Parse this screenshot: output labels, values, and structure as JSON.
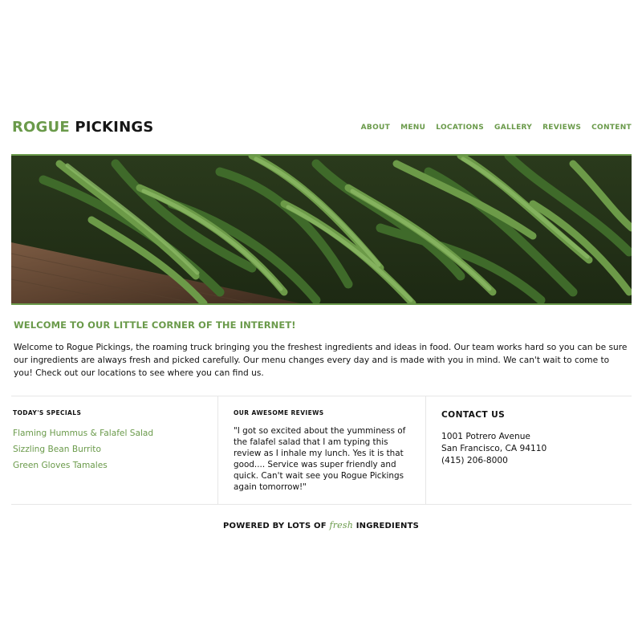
{
  "brand": {
    "word1": "ROGUE",
    "word2": "PICKINGS",
    "color_primary": "#6a9a4a"
  },
  "nav": {
    "items": [
      "ABOUT",
      "MENU",
      "LOCATIONS",
      "GALLERY",
      "REVIEWS",
      "CONTENT"
    ]
  },
  "hero": {
    "subject": "green beans in a wooden crate"
  },
  "welcome": {
    "title": "WELCOME TO OUR LITTLE CORNER OF THE INTERNET!",
    "text": "Welcome to Rogue Pickings, the roaming truck bringing you the freshest ingredients and ideas in food. Our team works hard so you can be sure our ingredients are always fresh and picked carefully. Our menu changes every day and is made with you in mind. We can't wait to come to you! Check out our locations to see where you can find us."
  },
  "specials": {
    "title": "TODAY'S SPECIALS",
    "items": [
      "Flaming Hummus & Falafel Salad",
      "Sizzling Bean Burrito",
      "Green Gloves Tamales"
    ]
  },
  "reviews": {
    "title": "OUR AWESOME REVIEWS",
    "quote": "\"I got so excited about the yumminess of the falafel salad that I am typing this review as I inhale my lunch. Yes it is that good.... Service was super friendly and quick. Can't wait see you Rogue Pickings again tomorrow!\""
  },
  "contact": {
    "title": "CONTACT US",
    "address1": "1001 Potrero Avenue",
    "address2": "San Francisco, CA 94110",
    "phone": "(415) 206-8000"
  },
  "footer": {
    "before": "POWERED BY LOTS OF",
    "fresh": "fresh",
    "after": "INGREDIENTS"
  }
}
